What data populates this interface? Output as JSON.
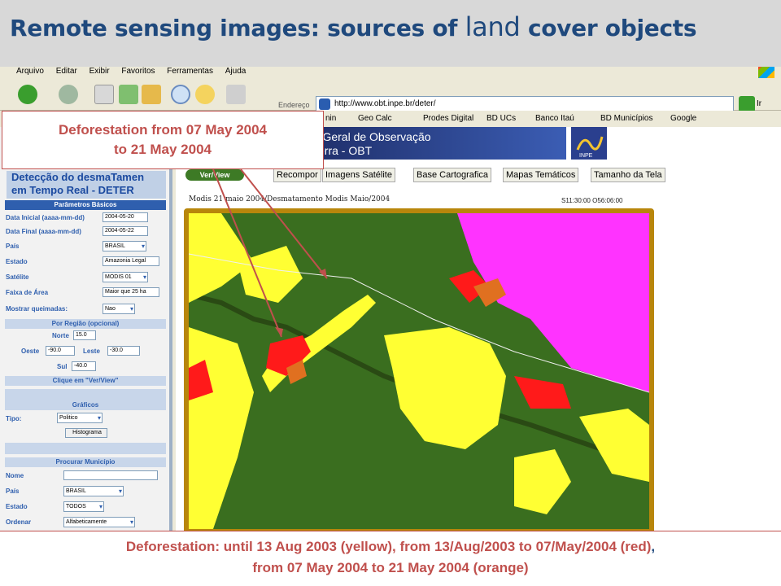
{
  "slide": {
    "title_a": "Remote sensing images: sources of ",
    "title_b": "land",
    "title_c": " cover objects"
  },
  "browser": {
    "menu": [
      "Arquivo",
      "Editar",
      "Exibir",
      "Favoritos",
      "Ferramentas",
      "Ajuda"
    ],
    "address_label": "Endereço",
    "address_url": "http://www.obt.inpe.br/deter/",
    "go_label": "Ir",
    "links": [
      "nin",
      "Geo Calc",
      "Prodes Digital",
      "BD UCs",
      "Banco Itaú",
      "BD Municípios",
      "Google"
    ]
  },
  "app": {
    "title_line1": "Detecção do desmaTamen",
    "title_line2": "em Tempo Real - DETER",
    "section_basic": "Parâmetros Básicos",
    "data_inicial_label": "Data Inicial (aaaa-mm-dd)",
    "data_inicial": "2004-05-20",
    "data_final_label": "Data Final (aaaa-mm-dd)",
    "data_final": "2004-05-22",
    "pais_label": "País",
    "pais": "BRASIL",
    "estado_label": "Estado",
    "estado": "Amazonia Legal",
    "satelite_label": "Satélite",
    "satelite": "MODIS 01",
    "faixa_label": "Faixa de Área",
    "faixa": "Maior que 25 ha",
    "queimadas_label": "Mostrar queimadas:",
    "queimadas": "Nao",
    "section_region": "Por Região (opcional)",
    "norte_label": "Norte",
    "norte": "15.0",
    "oeste_label": "Oeste",
    "oeste": "-90.0",
    "leste_label": "Leste",
    "leste": "-30.0",
    "sul_label": "Sul",
    "sul": "-40.0",
    "click_hint": "Clique em \"Ver/View\"",
    "section_graphs": "Gráficos",
    "tipo_label": "Tipo:",
    "tipo": "Politico",
    "histogram": "Histograma",
    "section_municipio": "Procurar Município",
    "nome_label": "Nome",
    "pais2_label": "País",
    "pais2": "BRASIL",
    "estado2_label": "Estado",
    "estado2": "TODOS",
    "ordenar_label": "Ordenar",
    "ordenar": "Alfabeticamente",
    "banner_line1": "o-Geral de Observação",
    "banner_line2": "Terra - OBT",
    "inpe_logo": "INPE",
    "verview": "Ver/View",
    "tabs": [
      "Recompor",
      "Imagens Satélite",
      "Base Cartografica",
      "Mapas Temáticos",
      "Tamanho da Tela"
    ],
    "map_caption": "Modis 21 maio 2004/Desmatamento Modis Maio/2004",
    "map_stamp": "S11:30:00 O56:06:00"
  },
  "callout_top": {
    "line1": "Deforestation  from 07 May 2004",
    "line2": "to 21 May 2004"
  },
  "callout_bottom": {
    "line1a": "Deforestation: until 13 Aug 2003 (yellow), from  13/Aug/2003 to 07/May/2004 (red)",
    "line1b": ",",
    "line2": "from 07 May 2004 to 21 May 2004 (orange)"
  },
  "colors": {
    "forest": "#3a6e1f",
    "deforest_old": "#ffff33",
    "deforest_mid": "#ff1a1a",
    "deforest_new": "#e07020",
    "cloud": "#ff33ff",
    "accent": "#c0504d",
    "title": "#1f497d"
  }
}
